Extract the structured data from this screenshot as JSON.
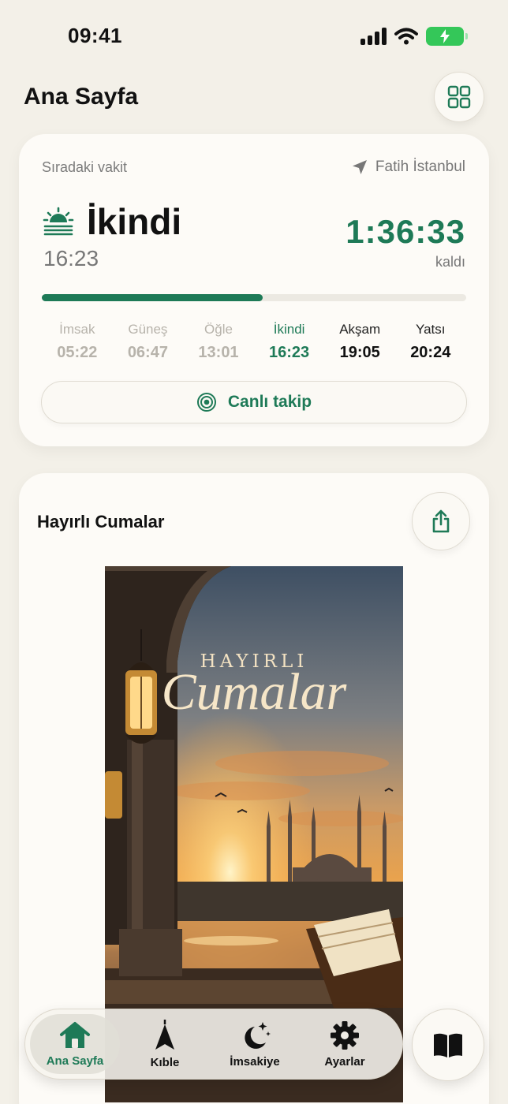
{
  "status_bar": {
    "time": "09:41"
  },
  "header": {
    "title": "Ana Sayfa",
    "grid_icon": "grid-icon"
  },
  "prayer_card": {
    "next_label": "Sıradaki vakit",
    "location": "Fatih İstanbul",
    "current_prayer": "İkindi",
    "current_time": "16:23",
    "countdown": "1:36:33",
    "remaining_label": "kaldı",
    "progress_fraction": 0.52,
    "times": [
      {
        "name": "İmsak",
        "time": "05:22",
        "state": "past"
      },
      {
        "name": "Güneş",
        "time": "06:47",
        "state": "past"
      },
      {
        "name": "Öğle",
        "time": "13:01",
        "state": "past"
      },
      {
        "name": "İkindi",
        "time": "16:23",
        "state": "active"
      },
      {
        "name": "Akşam",
        "time": "19:05",
        "state": "upcoming"
      },
      {
        "name": "Yatsı",
        "time": "20:24",
        "state": "upcoming"
      }
    ],
    "live_button": "Canlı takip"
  },
  "greeting_card": {
    "title": "Hayırlı Cumalar",
    "image_text_small": "HAYIRLI",
    "image_text_big": "Cumalar"
  },
  "bottom_nav": {
    "items": [
      {
        "label": "Ana Sayfa",
        "icon": "home-icon"
      },
      {
        "label": "Kıble",
        "icon": "qibla-icon"
      },
      {
        "label": "İmsakiye",
        "icon": "moon-stars-icon"
      },
      {
        "label": "Ayarlar",
        "icon": "gear-icon"
      }
    ],
    "book_icon": "book-icon"
  },
  "colors": {
    "accent": "#1e7a57",
    "background": "#f3f0e8",
    "card": "#fdfbf7"
  }
}
